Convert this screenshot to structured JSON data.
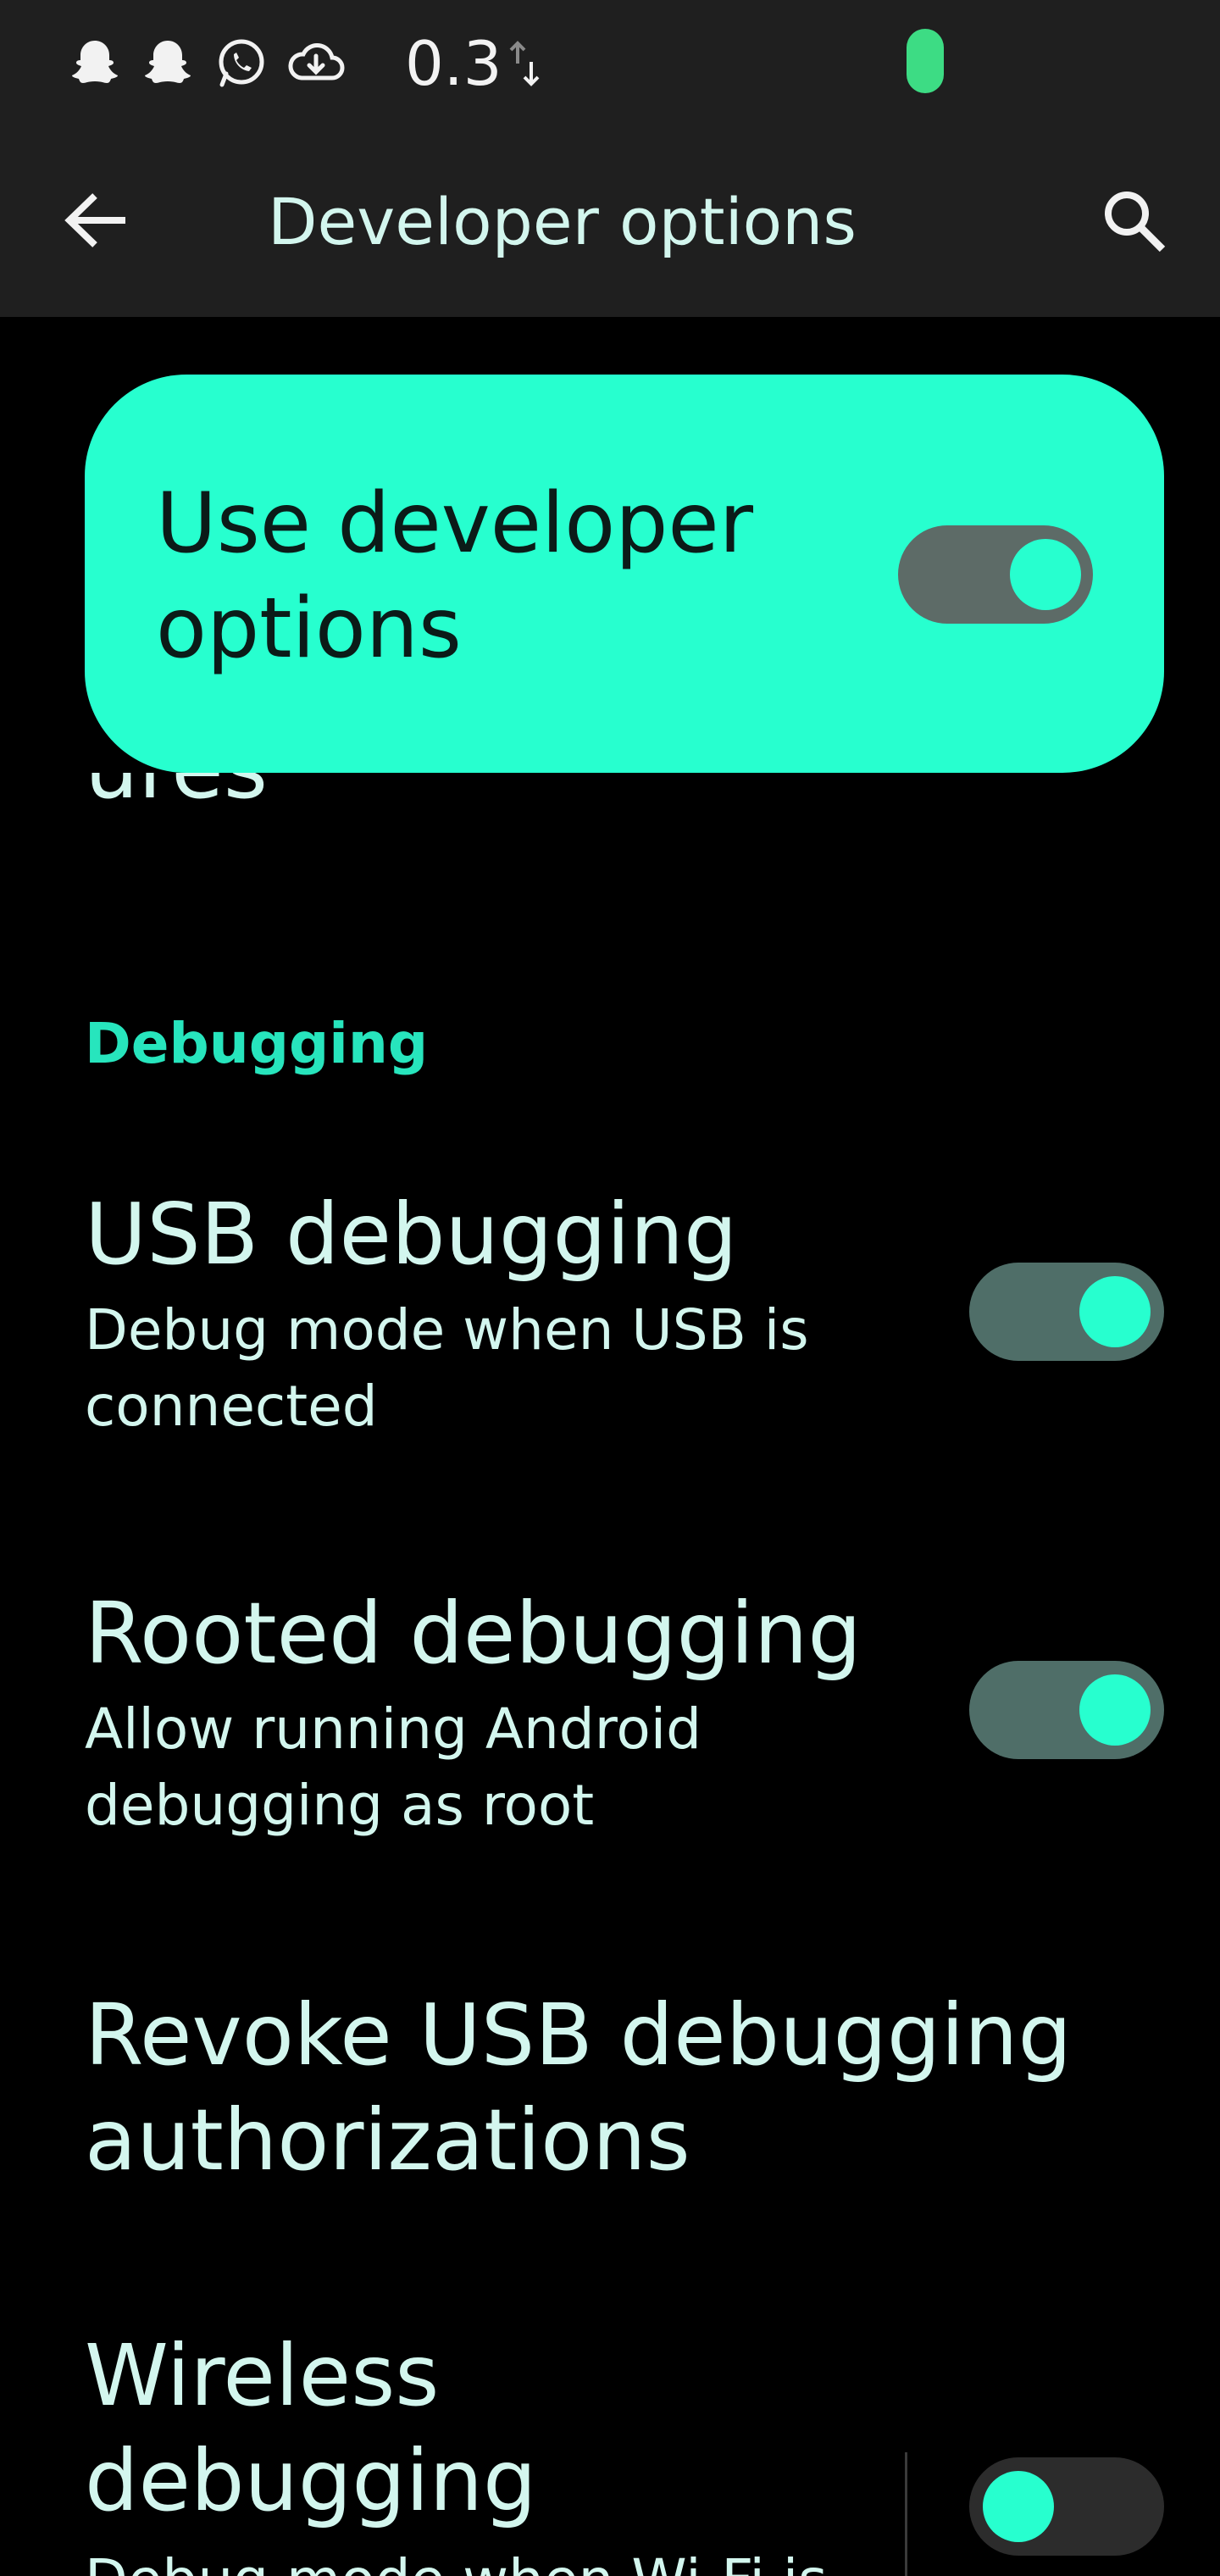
{
  "status_bar": {
    "icons": [
      "snapchat-icon",
      "snapchat-icon",
      "whatsapp-icon",
      "cloud-download-icon"
    ],
    "net_speed": "0.3",
    "net_arrows_icon": "up-down-arrows-icon",
    "camera_indicator_color": "#3ddc84"
  },
  "toolbar": {
    "title": "Developer options",
    "back_icon": "arrow-left-icon",
    "search_icon": "search-icon"
  },
  "main_switch": {
    "label": "Use developer options",
    "checked": true,
    "card_color": "#27ffcf"
  },
  "partial_item": {
    "visible_fragment": "ures"
  },
  "sections": {
    "debugging": {
      "header": "Debugging",
      "accent_color": "#27e5bd"
    }
  },
  "items": {
    "usb_debugging": {
      "title": "USB debugging",
      "summary": "Debug mode when USB is connected",
      "checked": true
    },
    "rooted_debugging": {
      "title": "Rooted debugging",
      "summary": "Allow running Android debugging as root",
      "checked": true
    },
    "revoke_usb": {
      "title": "Revoke USB debugging authorizations"
    },
    "wireless_debugging": {
      "title": "Wireless debugging",
      "summary": "Debug mode when Wi-Fi is connected",
      "checked": false
    }
  }
}
